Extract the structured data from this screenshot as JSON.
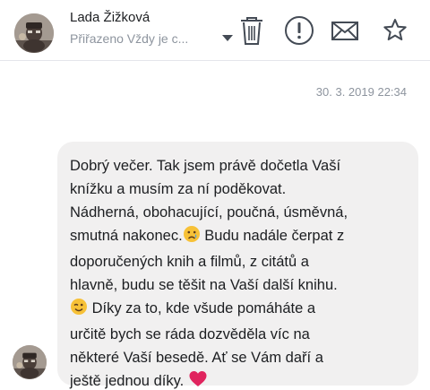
{
  "contact": {
    "name": "Lada Žižková",
    "assignment": "Přiřazeno Vždy je c..."
  },
  "toolbar": {
    "delete_icon": "trash-icon",
    "report_icon": "exclamation-circle-icon",
    "unread_icon": "envelope-icon",
    "star_icon": "star-icon"
  },
  "conversation": {
    "timestamp": "30. 3. 2019 22:34",
    "message": {
      "lines": [
        "Dobrý večer. Tak jsem právě dočetla Vaší",
        "knížku a musím za ní poděkovat.",
        "Nádherná, obohacující, poučná, úsměvná,",
        "smutná nakonec.",
        " Budu nadále čerpat z",
        "doporučených knih a filmů, z citátů a",
        "hlavně, budu se těšit na Vaší další knihu.",
        " Díky za to, kde všude pomáháte a",
        "určitě bych se ráda dozvěděla víc na",
        "některé Vaší besedě. Ať se Vám daří a",
        "ještě jednou díky. "
      ],
      "emojis": [
        "sad-tear-emoji",
        "wink-emoji",
        "red-heart-emoji"
      ]
    }
  },
  "colors": {
    "bubble_bg": "#f1f0f0",
    "muted_text": "#8d949e",
    "icon_stroke": "#444b55",
    "heart": "#e0245e",
    "emoji_face": "#f7c137"
  }
}
